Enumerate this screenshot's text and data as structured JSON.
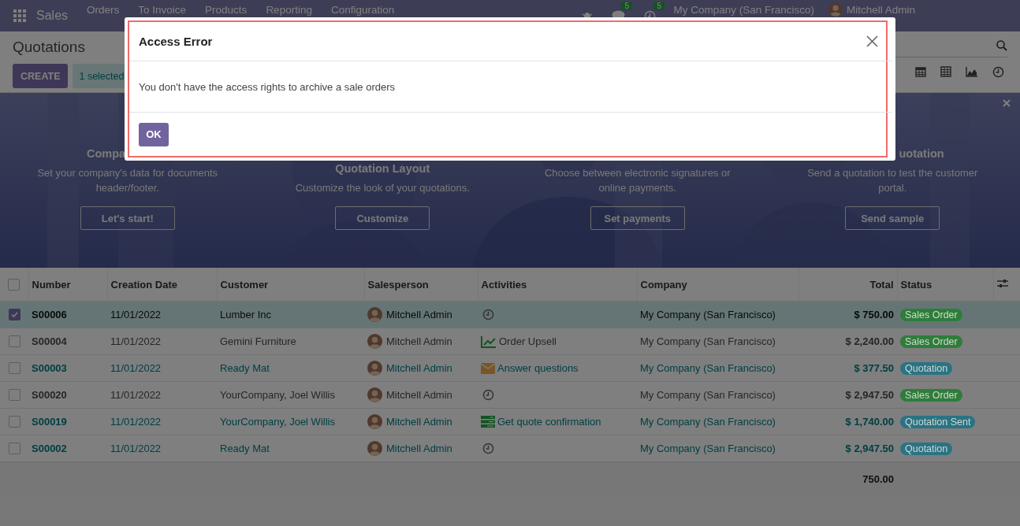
{
  "navbar": {
    "app": "Sales",
    "menu": [
      "Orders",
      "To Invoice",
      "Products",
      "Reporting",
      "Configuration"
    ],
    "messages_badge": "5",
    "activities_badge": "5",
    "company": "My Company (San Francisco)",
    "user": "Mitchell Admin"
  },
  "control_panel": {
    "title": "Quotations",
    "create_button": "CREATE",
    "selection": "1 selected"
  },
  "banner": {
    "steps": [
      {
        "title": "Compa",
        "description": "Set your company's data for documents header/footer.",
        "button": "Let's start!"
      },
      {
        "title": "Quotation Layout",
        "description": "Customize the look of your quotations.",
        "button": "Customize"
      },
      {
        "description": "Choose between electronic signatures or online payments.",
        "button": "Set payments"
      },
      {
        "title": "uotation",
        "description": "Send a quotation to test the customer portal.",
        "button": "Send sample"
      }
    ]
  },
  "table": {
    "all_selected": false,
    "columns": [
      "Number",
      "Creation Date",
      "Customer",
      "Salesperson",
      "Activities",
      "Company",
      "Total",
      "Status"
    ],
    "rows": [
      {
        "selected": true,
        "kind": "default",
        "number": "S00006",
        "date": "11/01/2022",
        "customer": "Lumber Inc",
        "salesperson": "Mitchell Admin",
        "activity": {
          "kind": "clock"
        },
        "company": "My Company (San Francisco)",
        "total": "$ 750.00",
        "status": {
          "label": "Sales Order",
          "color": "#2e7d3a"
        }
      },
      {
        "selected": false,
        "kind": "default",
        "number": "S00004",
        "date": "11/01/2022",
        "customer": "Gemini Furniture",
        "salesperson": "Mitchell Admin",
        "activity": {
          "kind": "chart",
          "label": "Order Upsell"
        },
        "company": "My Company (San Francisco)",
        "total": "$ 2,240.00",
        "status": {
          "label": "Sales Order",
          "color": "#2e7d3a"
        }
      },
      {
        "selected": false,
        "kind": "info",
        "number": "S00003",
        "date": "11/01/2022",
        "customer": "Ready Mat",
        "salesperson": "Mitchell Admin",
        "activity": {
          "kind": "envelope",
          "label": "Answer questions"
        },
        "company": "My Company (San Francisco)",
        "total": "$ 377.50",
        "status": {
          "label": "Quotation",
          "color": "#2a7385"
        }
      },
      {
        "selected": false,
        "kind": "default",
        "number": "S00020",
        "date": "11/01/2022",
        "customer": "YourCompany, Joel Willis",
        "salesperson": "Mitchell Admin",
        "activity": {
          "kind": "clock"
        },
        "company": "My Company (San Francisco)",
        "total": "$ 2,947.50",
        "status": {
          "label": "Sales Order",
          "color": "#2e7d3a"
        }
      },
      {
        "selected": false,
        "kind": "info",
        "number": "S00019",
        "date": "11/01/2022",
        "customer": "YourCompany, Joel Willis",
        "salesperson": "Mitchell Admin",
        "activity": {
          "kind": "tasks",
          "label": "Get quote confirmation"
        },
        "company": "My Company (San Francisco)",
        "total": "$ 1,740.00",
        "status": {
          "label": "Quotation Sent",
          "color": "#2a7385"
        }
      },
      {
        "selected": false,
        "kind": "info",
        "number": "S00002",
        "date": "11/01/2022",
        "customer": "Ready Mat",
        "salesperson": "Mitchell Admin",
        "activity": {
          "kind": "clock"
        },
        "company": "My Company (San Francisco)",
        "total": "$ 2,947.50",
        "status": {
          "label": "Quotation",
          "color": "#2a7385"
        }
      }
    ],
    "footer_total": "750.00"
  },
  "dialog": {
    "title": "Access Error",
    "message": "You don't have the access rights to archive a sale orders",
    "button": "OK"
  }
}
